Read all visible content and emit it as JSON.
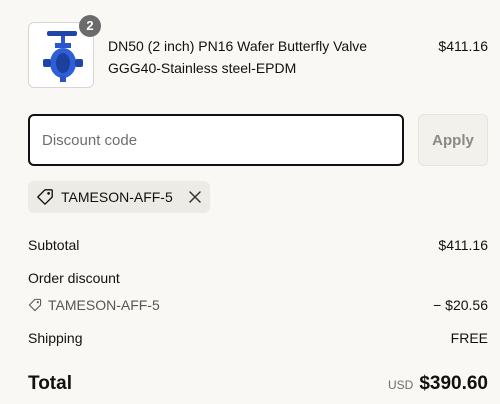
{
  "line_item": {
    "quantity": "2",
    "title_line1": "DN50 (2 inch) PN16 Wafer Butterfly Valve",
    "title_line2": "GGG40-Stainless steel-EPDM",
    "price": "$411.16",
    "image_icon": "butterfly-valve-image",
    "image_color": "#2a56c9"
  },
  "discount": {
    "placeholder": "Discount code",
    "value": "",
    "apply_label": "Apply",
    "applied_code": "TAMESON-AFF-5"
  },
  "summary": {
    "subtotal_label": "Subtotal",
    "subtotal_value": "$411.16",
    "order_discount_label": "Order discount",
    "discount_code": "TAMESON-AFF-5",
    "discount_value": "− $20.56",
    "shipping_label": "Shipping",
    "shipping_value": "FREE",
    "total_label": "Total",
    "currency": "USD",
    "total_value": "$390.60"
  }
}
